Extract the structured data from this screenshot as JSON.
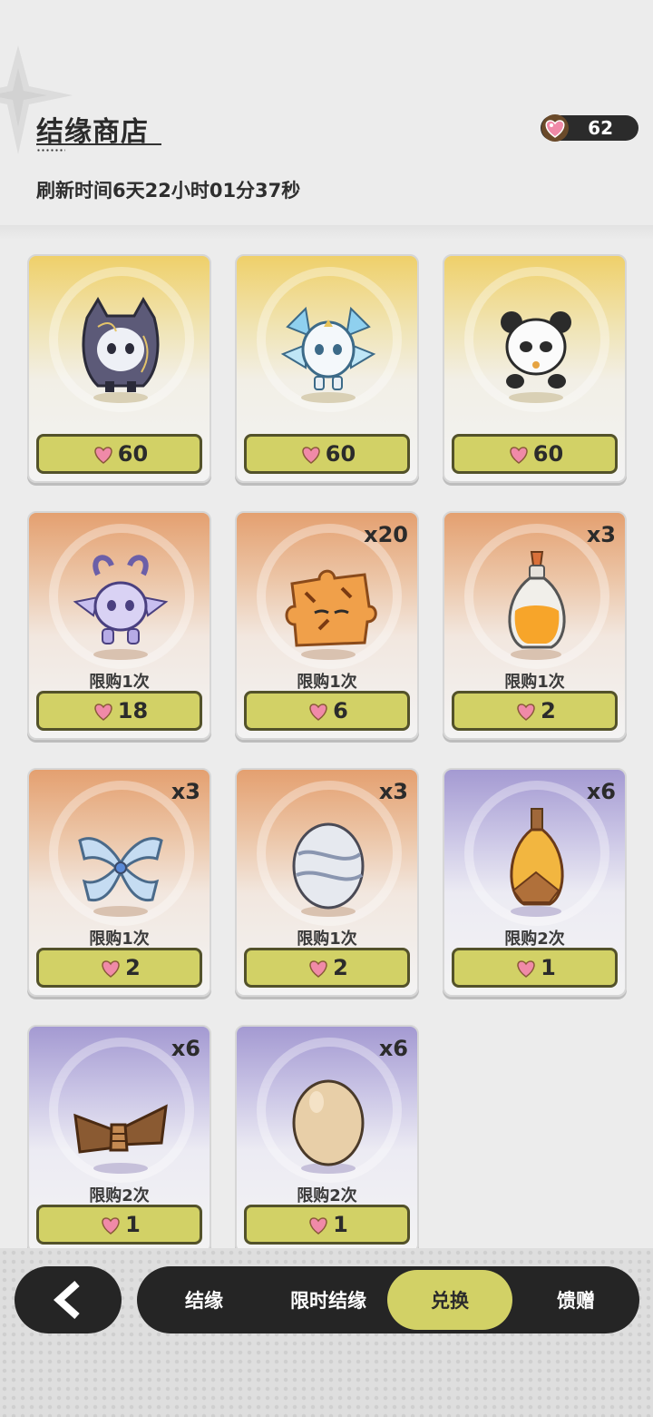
{
  "header": {
    "title": "结缘商店",
    "refresh_text": "刷新时间6天22小时01分37秒",
    "currency_value": "62",
    "currency_icon": "heart-gem-icon"
  },
  "items": [
    {
      "price": "60",
      "quantity": "",
      "limit": "",
      "theme": "gold",
      "icon": "dark-hooded-creature-icon"
    },
    {
      "price": "60",
      "quantity": "",
      "limit": "",
      "theme": "gold",
      "icon": "winged-crystal-creature-icon"
    },
    {
      "price": "60",
      "quantity": "",
      "limit": "",
      "theme": "gold",
      "icon": "panda-creature-icon"
    },
    {
      "price": "18",
      "quantity": "",
      "limit": "限购1次",
      "theme": "orange",
      "icon": "horned-purple-creature-icon"
    },
    {
      "price": "6",
      "quantity": "x20",
      "limit": "限购1次",
      "theme": "orange",
      "icon": "tiger-puzzle-piece-icon"
    },
    {
      "price": "2",
      "quantity": "x3",
      "limit": "限购1次",
      "theme": "orange",
      "icon": "orange-potion-bottle-icon"
    },
    {
      "price": "2",
      "quantity": "x3",
      "limit": "限购1次",
      "theme": "orange",
      "icon": "blue-scroll-bundle-icon"
    },
    {
      "price": "2",
      "quantity": "x3",
      "limit": "限购1次",
      "theme": "orange",
      "icon": "silver-egg-icon"
    },
    {
      "price": "1",
      "quantity": "x6",
      "limit": "限购2次",
      "theme": "purple",
      "icon": "bronze-potion-bottle-icon"
    },
    {
      "price": "1",
      "quantity": "x6",
      "limit": "限购2次",
      "theme": "purple",
      "icon": "brown-feather-bundle-icon"
    },
    {
      "price": "1",
      "quantity": "x6",
      "limit": "限购2次",
      "theme": "purple",
      "icon": "plain-egg-icon"
    }
  ],
  "nav": {
    "back_icon": "chevron-left-icon",
    "tabs": [
      {
        "label": "结缘",
        "active": false
      },
      {
        "label": "限时结缘",
        "active": false
      },
      {
        "label": "兑换",
        "active": true
      },
      {
        "label": "馈赠",
        "active": false
      }
    ]
  },
  "colors": {
    "accent": "#d2d166",
    "dark": "#252525",
    "gold": "#efd06a",
    "orange": "#e4a070",
    "purple": "#a49ad2"
  }
}
